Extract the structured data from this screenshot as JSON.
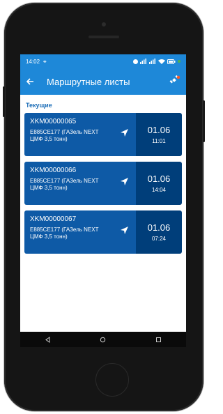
{
  "status_bar": {
    "time": "14:02"
  },
  "appbar": {
    "title": "Маршрутные листы"
  },
  "section": {
    "label": "Текущие"
  },
  "routes": [
    {
      "code": "XKM00000065",
      "vehicle": "Е885СЕ177 (ГАЗель NEXT ЦМФ 3,5 тонн)",
      "date": "01.06",
      "time": "11:01"
    },
    {
      "code": "XKM00000066",
      "vehicle": "Е885СЕ177 (ГАЗель NEXT ЦМФ 3,5 тонн)",
      "date": "01.06",
      "time": "14:04"
    },
    {
      "code": "XKM00000067",
      "vehicle": "Е885СЕ177 (ГАЗель NEXT ЦМФ 3,5 тонн)",
      "date": "01.06",
      "time": "07:24"
    }
  ],
  "colors": {
    "primary": "#1e88d8",
    "card": "#0e5aa6",
    "card_date": "#003e7a",
    "badge": "#ff5722",
    "status_dot": "#4caf50"
  },
  "icons": [
    "back-arrow-icon",
    "satellite-icon",
    "navigation-arrow-icon",
    "back-nav-icon",
    "home-nav-icon",
    "recents-nav-icon"
  ]
}
